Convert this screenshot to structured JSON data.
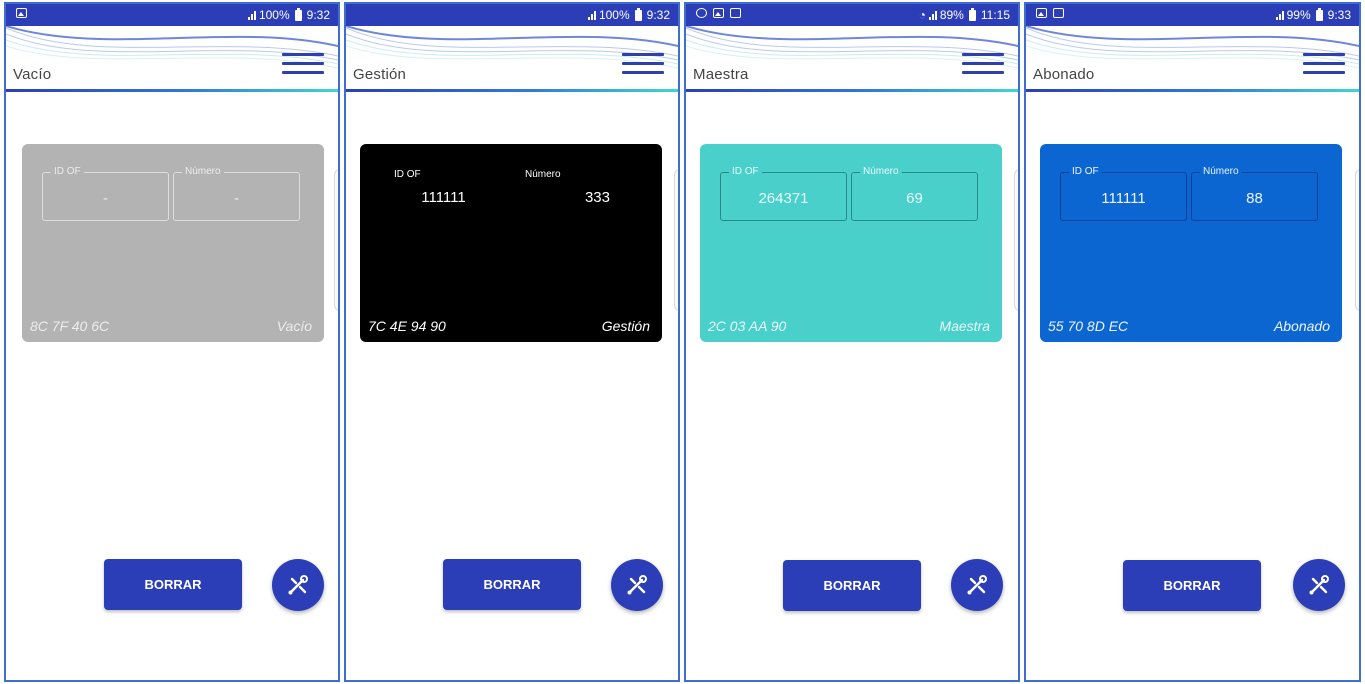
{
  "accent_color": "#2b3eb7",
  "screens": [
    {
      "status": {
        "left_icons": [
          "image-icon"
        ],
        "right_text": "100%",
        "time": "9:32"
      },
      "header_title": "Vacío",
      "card": {
        "color": "#b3b3b3",
        "label_id": "ID OF",
        "label_num": "Número",
        "value_id": "-",
        "value_num": "-",
        "uid": "8C 7F 40 6C",
        "type": "Vacío"
      },
      "borrar_label": "BORRAR"
    },
    {
      "status": {
        "left_icons": [],
        "right_text": "100%",
        "time": "9:32"
      },
      "header_title": "Gestión",
      "card": {
        "color": "#000000",
        "label_id": "ID OF",
        "label_num": "Número",
        "value_id": "111111",
        "value_num": "333",
        "uid": "7C 4E 94 90",
        "type": "Gestión"
      },
      "borrar_label": "BORRAR"
    },
    {
      "status": {
        "left_icons": [
          "sync-icon",
          "image-icon",
          "image-icon"
        ],
        "right_text": "89%",
        "time": "11:15"
      },
      "header_title": "Maestra",
      "card": {
        "color": "#4ad0cb",
        "label_id": "ID OF",
        "label_num": "Número",
        "value_id": "264371",
        "value_num": "69",
        "uid": "2C 03 AA 90",
        "type": "Maestra"
      },
      "borrar_label": "BORRAR"
    },
    {
      "status": {
        "left_icons": [
          "image-icon",
          "image-icon"
        ],
        "right_text": "99%",
        "time": "9:33"
      },
      "header_title": "Abonado",
      "card": {
        "color": "#0b66d2",
        "label_id": "ID OF",
        "label_num": "Número",
        "value_id": "111111",
        "value_num": "88",
        "uid": "55 70 8D EC",
        "type": "Abonado"
      },
      "borrar_label": "BORRAR"
    }
  ]
}
